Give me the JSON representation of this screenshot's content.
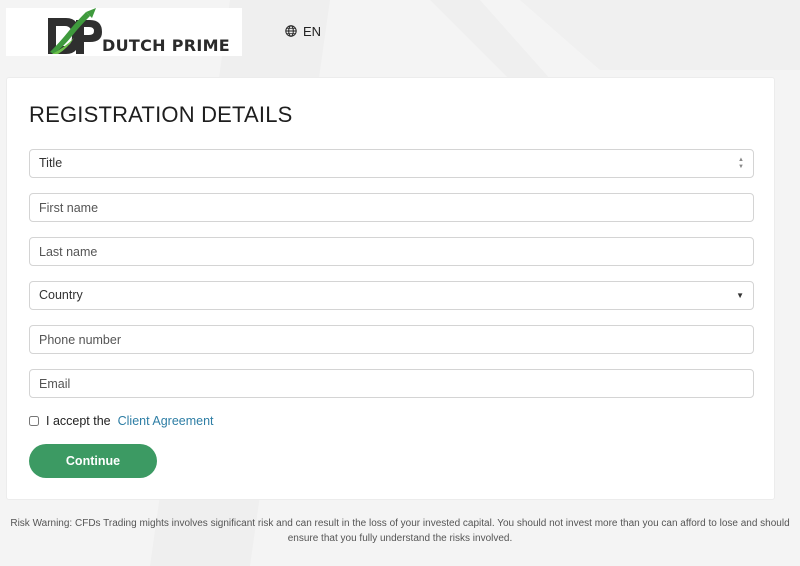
{
  "header": {
    "logo_text": "DUTCH PRIME",
    "language": "EN",
    "language_icon": "globe-icon"
  },
  "form": {
    "title": "REGISTRATION DETAILS",
    "title_select": "Title",
    "first_name_placeholder": "First name",
    "last_name_placeholder": "Last name",
    "country_select": "Country",
    "phone_placeholder": "Phone number",
    "email_placeholder": "Email",
    "agree_text": "I accept the",
    "agree_link": "Client Agreement",
    "continue_label": "Continue"
  },
  "footer": {
    "risk_warning": "Risk Warning: CFDs Trading mights involves significant risk and can result in the loss of your invested capital. You should not invest more than you can afford to lose and should ensure that you fully understand the risks involved."
  },
  "colors": {
    "accent": "#3c9a63",
    "link": "#2e7ea5",
    "logo_green": "#2f7d3b"
  }
}
